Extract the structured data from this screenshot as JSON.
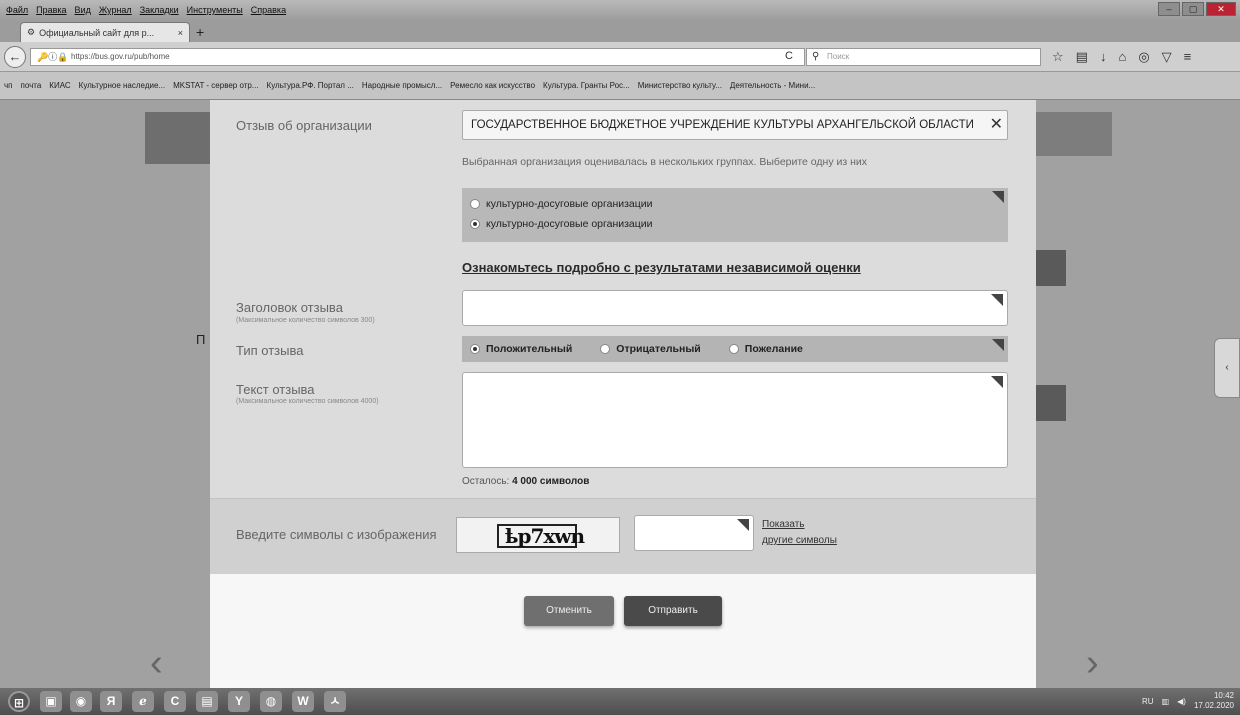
{
  "browser": {
    "menu": [
      "Файл",
      "Правка",
      "Вид",
      "Журнал",
      "Закладки",
      "Инструменты",
      "Справка"
    ],
    "window_controls": [
      "–",
      "▢",
      "✕"
    ],
    "tab_title": "Официальный сайт для р...",
    "tab_close": "×",
    "new_tab": "+",
    "url": "https://bus.gov.ru/pub/home",
    "search_placeholder": "Поиск",
    "bookmarks": [
      "чп",
      "почта",
      "КИАС",
      "Культурное наследие...",
      "MKSTAT - сервер отр...",
      "Культура.РФ. Портал ...",
      "Народные промысл...",
      "Ремесло как искусство",
      "Культура. Гранты Рос...",
      "Министерство культу...",
      "Деятельность - Мини..."
    ]
  },
  "form": {
    "org_label": "Отзыв об организации",
    "org_value": "ГОСУДАРСТВЕННОЕ БЮДЖЕТНОЕ УЧРЕЖДЕНИЕ КУЛЬТУРЫ АРХАНГЕЛЬСКОЙ ОБЛАСТИ",
    "group_hint": "Выбранная организация оценивалась в нескольких группах. Выберите одну из них",
    "groups": [
      {
        "label": "культурно-досуговые организации",
        "selected": false
      },
      {
        "label": "культурно-досуговые организации",
        "selected": true
      }
    ],
    "results_link": "Ознакомьтесь подробно с результатами независимой оценки",
    "title_label": "Заголовок отзыва",
    "title_sublabel": "(Максимальное количество символов 300)",
    "type_label": "Тип отзыва",
    "types": [
      {
        "label": "Положительный",
        "selected": true
      },
      {
        "label": "Отрицательный",
        "selected": false
      },
      {
        "label": "Пожелание",
        "selected": false
      }
    ],
    "text_label": "Текст отзыва",
    "text_sublabel": "(Максимальное количество символов 4000)",
    "remaining_prefix": "Осталось:",
    "remaining_value": "4 000 символов",
    "captcha_label": "Введите символы с изображения",
    "captcha_text": "ҍp7xwn",
    "captcha_show": "Показать",
    "captcha_other": "другие символы",
    "cancel": "Отменить",
    "send": "Отправить"
  },
  "background": {
    "left_arrow": "‹",
    "right_arrow": "›",
    "left_fragment": "П"
  },
  "taskbar": {
    "apps": [
      "⊞",
      "▣",
      "◉",
      "Я",
      "ℯ",
      "C",
      "▤",
      "Y",
      "◍",
      "W",
      "ㅅ"
    ],
    "lang": "RU",
    "time": "10:42",
    "date": "17.02.2020"
  },
  "icons": {
    "org_clear": "clear-x-icon",
    "reload": "reload-icon",
    "star": "bookmark-star-icon",
    "download": "download-icon",
    "home": "home-icon",
    "pocket": "pocket-icon",
    "menu": "hamburger-menu-icon"
  }
}
